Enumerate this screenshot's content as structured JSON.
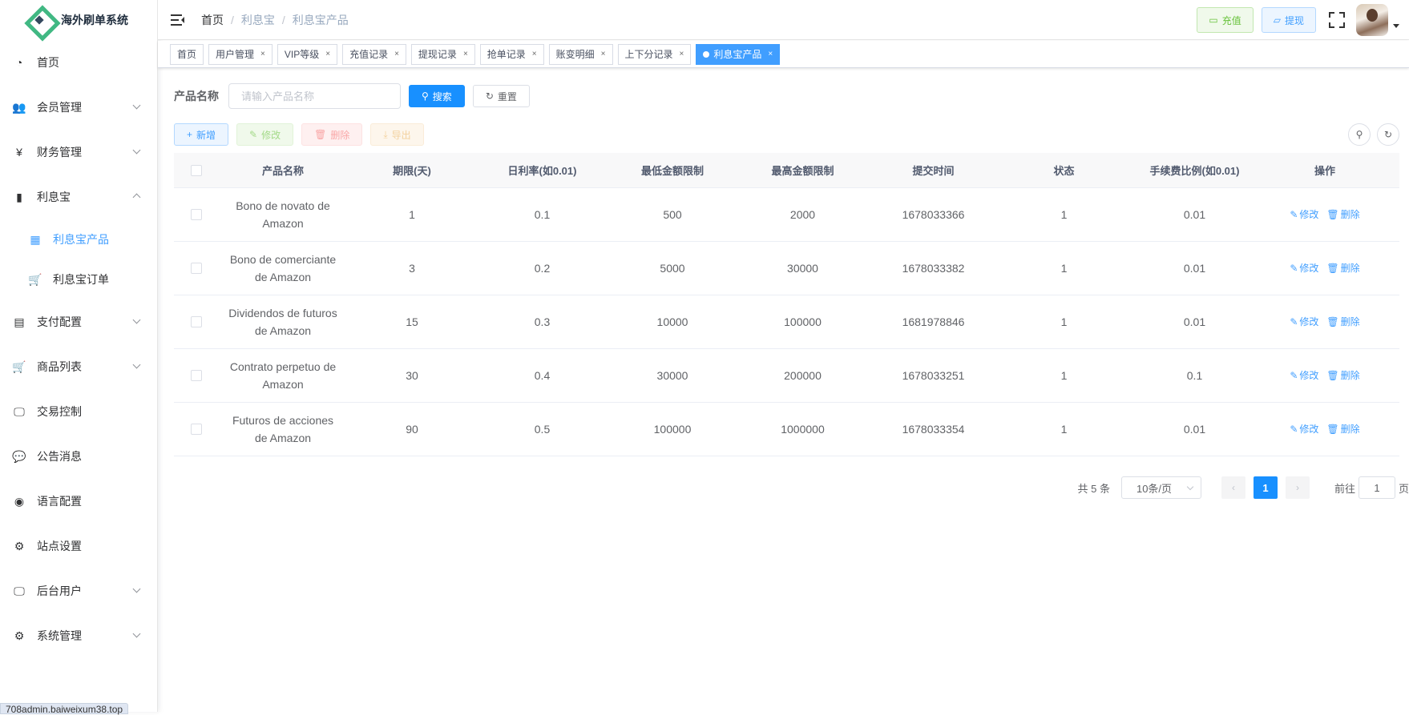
{
  "app": {
    "title": "海外刷单系统"
  },
  "sidebar": {
    "items": [
      {
        "label": "首页",
        "icon": "dashboard-icon",
        "glyph": "◔",
        "expandable": false
      },
      {
        "label": "会员管理",
        "icon": "users-icon",
        "glyph": "👥",
        "expandable": true,
        "expanded": false
      },
      {
        "label": "财务管理",
        "icon": "yen-icon",
        "glyph": "¥",
        "expandable": true,
        "expanded": false
      },
      {
        "label": "利息宝",
        "icon": "bar-chart-icon",
        "glyph": "▮",
        "expandable": true,
        "expanded": true,
        "children": [
          {
            "label": "利息宝产品",
            "icon": "table-icon",
            "glyph": "▦",
            "active": true
          },
          {
            "label": "利息宝订单",
            "icon": "cart-icon",
            "glyph": "🛒",
            "active": false
          }
        ]
      },
      {
        "label": "支付配置",
        "icon": "receipt-icon",
        "glyph": "▤",
        "expandable": true,
        "expanded": false
      },
      {
        "label": "商品列表",
        "icon": "cart-icon",
        "glyph": "🛒",
        "expandable": true,
        "expanded": false
      },
      {
        "label": "交易控制",
        "icon": "monitor-icon",
        "glyph": "🖵",
        "expandable": false
      },
      {
        "label": "公告消息",
        "icon": "message-icon",
        "glyph": "💬",
        "expandable": false
      },
      {
        "label": "语言配置",
        "icon": "globe-icon",
        "glyph": "◉",
        "expandable": false
      },
      {
        "label": "站点设置",
        "icon": "gear-icon",
        "glyph": "⚙",
        "expandable": false
      },
      {
        "label": "后台用户",
        "icon": "monitor-user-icon",
        "glyph": "🖵",
        "expandable": true,
        "expanded": false
      },
      {
        "label": "系统管理",
        "icon": "settings-icon",
        "glyph": "⚙",
        "expandable": true,
        "expanded": false
      }
    ],
    "status_url": "708admin.baiweixum38.top"
  },
  "header": {
    "breadcrumb": [
      "首页",
      "利息宝",
      "利息宝产品"
    ],
    "recharge_label": "充值",
    "withdraw_label": "提现"
  },
  "tags": [
    {
      "label": "首页",
      "closable": false,
      "active": false
    },
    {
      "label": "用户管理",
      "closable": true,
      "active": false
    },
    {
      "label": "VIP等级",
      "closable": true,
      "active": false
    },
    {
      "label": "充值记录",
      "closable": true,
      "active": false
    },
    {
      "label": "提现记录",
      "closable": true,
      "active": false
    },
    {
      "label": "抢单记录",
      "closable": true,
      "active": false
    },
    {
      "label": "账变明细",
      "closable": true,
      "active": false
    },
    {
      "label": "上下分记录",
      "closable": true,
      "active": false
    },
    {
      "label": "利息宝产品",
      "closable": true,
      "active": true
    }
  ],
  "search": {
    "label": "产品名称",
    "placeholder": "请输入产品名称",
    "value": "",
    "search_label": "搜索",
    "reset_label": "重置"
  },
  "toolbar": {
    "add_label": "新增",
    "edit_label": "修改",
    "delete_label": "删除",
    "export_label": "导出"
  },
  "table": {
    "columns": [
      "产品名称",
      "期限(天)",
      "日利率(如0.01)",
      "最低金额限制",
      "最高金额限制",
      "提交时间",
      "状态",
      "手续费比例(如0.01)",
      "操作"
    ],
    "edit_label": "修改",
    "delete_label": "删除",
    "rows": [
      {
        "name": "Bono de novato de Amazon",
        "days": "1",
        "rate": "0.1",
        "min": "500",
        "max": "2000",
        "time": "1678033366",
        "status": "1",
        "fee": "0.01"
      },
      {
        "name": "Bono de comerciante de Amazon",
        "days": "3",
        "rate": "0.2",
        "min": "5000",
        "max": "30000",
        "time": "1678033382",
        "status": "1",
        "fee": "0.01"
      },
      {
        "name": "Dividendos de futuros de Amazon",
        "days": "15",
        "rate": "0.3",
        "min": "10000",
        "max": "100000",
        "time": "1681978846",
        "status": "1",
        "fee": "0.01"
      },
      {
        "name": "Contrato perpetuo de Amazon",
        "days": "30",
        "rate": "0.4",
        "min": "30000",
        "max": "200000",
        "time": "1678033251",
        "status": "1",
        "fee": "0.1"
      },
      {
        "name": "Futuros de acciones de Amazon",
        "days": "90",
        "rate": "0.5",
        "min": "100000",
        "max": "1000000",
        "time": "1678033354",
        "status": "1",
        "fee": "0.01"
      }
    ]
  },
  "pagination": {
    "total_text": "共 5 条",
    "page_size": "10条/页",
    "current_page": "1",
    "goto_prefix": "前往",
    "goto_value": "1",
    "goto_suffix": "页"
  },
  "colors": {
    "primary": "#1890ff",
    "active_text": "#409eff",
    "logo_green": "#41b883"
  }
}
